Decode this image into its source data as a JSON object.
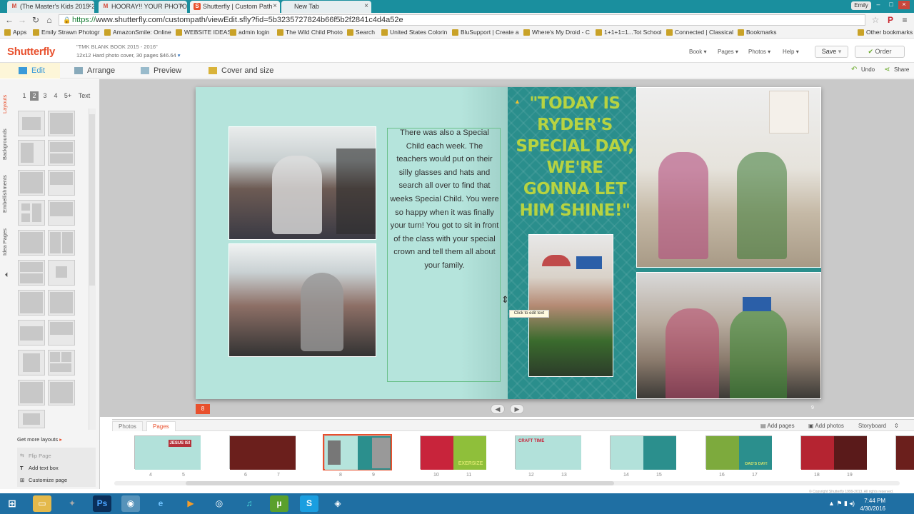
{
  "browser": {
    "tabs": [
      {
        "label": "(The Master's Kids 2015-2",
        "fav": "M",
        "favColor": "#d34a3a"
      },
      {
        "label": "HOORAY!! YOUR PHOTO",
        "fav": "M",
        "favColor": "#d34a3a"
      },
      {
        "label": "Shutterfly | Custom Path",
        "fav": "S",
        "favColor": "#e8502d"
      },
      {
        "label": "New Tab",
        "fav": "",
        "favColor": "#999"
      }
    ],
    "user": "Emily",
    "url_proto": "https://",
    "url_rest": "www.shutterfly.com/custompath/viewEdit.sfly?fid=5b3235727824b66f5b2f2841c4d4a52e",
    "bookmarks": [
      "Apps",
      "Emily Strawn Photogr",
      "AmazonSmile: Online",
      "WEBSITE IDEAS",
      "admin login",
      "The Wild Child Photo",
      "Search",
      "United States Colorin",
      "BluSupport | Create a",
      "Where's My Droid - C",
      "1+1+1=1...Tot School",
      "Connected | Classical",
      "Bookmarks",
      "Other bookmarks"
    ]
  },
  "app": {
    "logo": "Shutterfly",
    "project_title": "\"TMK BLANK BOOK 2015 - 2016\"",
    "project_sub": "12x12 Hard photo cover, 30 pages $46.64",
    "menu": [
      "Book",
      "Pages",
      "Photos",
      "Help"
    ],
    "save": "Save",
    "order": "Order",
    "undo": "Undo",
    "share": "Share"
  },
  "toolbar": [
    "Edit",
    "Arrange",
    "Preview",
    "Cover and size"
  ],
  "left_panel": {
    "vtabs": [
      "Layouts",
      "Backgrounds",
      "Embellishments",
      "Idea Pages"
    ],
    "page_tabs": [
      "1",
      "2",
      "3",
      "4",
      "5+",
      "Text"
    ],
    "more_layouts": "Get more layouts",
    "options": [
      "Flip Page",
      "Add text box",
      "Customize page"
    ]
  },
  "spread": {
    "body_text": "There was also a Special Child each week. The teachers would put on their silly glasses and hats and search all over to find that weeks Special Child. You were so happy when it was finally your turn! You got to sit in front of the class with your special crown and tell them all about your family.",
    "quote": "\"TODAY IS RYDER'S SPECIAL DAY, WE'RE GONNA LET HIM SHINE!\"",
    "tooltip": "Click to edit text",
    "page_left_num": "8",
    "page_right_num": "9"
  },
  "bottom": {
    "tabs": [
      "Photos",
      "Pages"
    ],
    "actions": [
      "Add pages",
      "Add photos",
      "Storyboard"
    ],
    "thumb_labels": [
      {
        "left": "4",
        "right": "5",
        "text": "JESUS IS!"
      },
      {
        "left": "6",
        "right": "7",
        "text": ""
      },
      {
        "left": "8",
        "right": "9",
        "text": ""
      },
      {
        "left": "10",
        "right": "11",
        "text": "EXERSIZE"
      },
      {
        "left": "12",
        "right": "13",
        "text": "CRAFT TIME"
      },
      {
        "left": "14",
        "right": "15",
        "text": ""
      },
      {
        "left": "16",
        "right": "17",
        "text": "DAD'S DAY!"
      },
      {
        "left": "18",
        "right": "19",
        "text": ""
      }
    ],
    "copyright": "© Copyright Shutterfly 1999-2013. All rights reserved."
  },
  "taskbar": {
    "time": "7:44 PM",
    "date": "4/30/2016"
  }
}
